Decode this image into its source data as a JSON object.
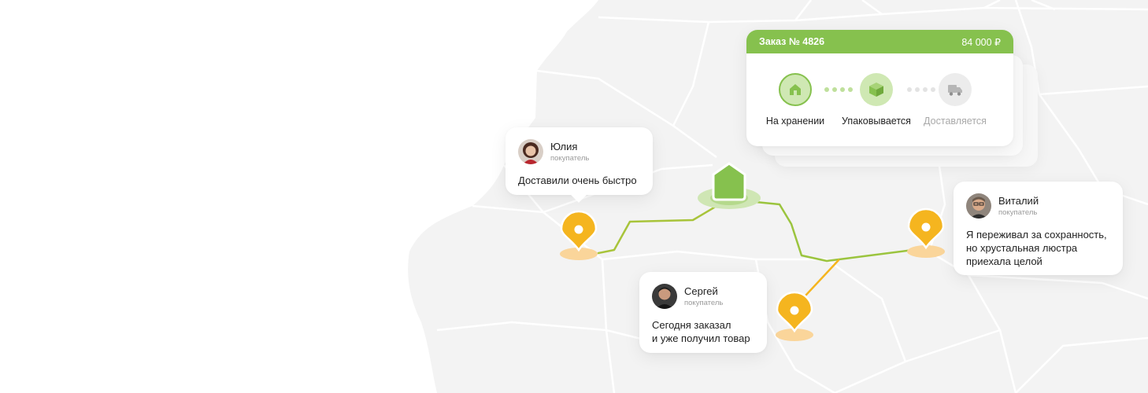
{
  "colors": {
    "accent_green": "#86c14e",
    "pin_orange": "#f5b51f",
    "map_fill": "#f3f3f3",
    "map_lines": "#ffffff"
  },
  "order": {
    "title": "Заказ № 4826",
    "amount": "84 000 ₽",
    "steps": [
      {
        "label": "На хранении",
        "icon": "house-icon",
        "state": "done"
      },
      {
        "label": "Упаковывается",
        "icon": "box-icon",
        "state": "active"
      },
      {
        "label": "Доставляется",
        "icon": "truck-icon",
        "state": "pending"
      }
    ]
  },
  "reviews": [
    {
      "name": "Юлия",
      "role": "покупатель",
      "text": "Доставили очень быстро"
    },
    {
      "name": "Сергей",
      "role": "покупатель",
      "text": "Сегодня заказал\nи уже получил товар"
    },
    {
      "name": "Виталий",
      "role": "покупатель",
      "text": "Я переживал за сохранность,\nно хрустальная люстра\nприехала целой"
    }
  ],
  "map": {
    "warehouse_icon": "warehouse-pin-icon",
    "pin_icon": "map-pin-icon"
  }
}
